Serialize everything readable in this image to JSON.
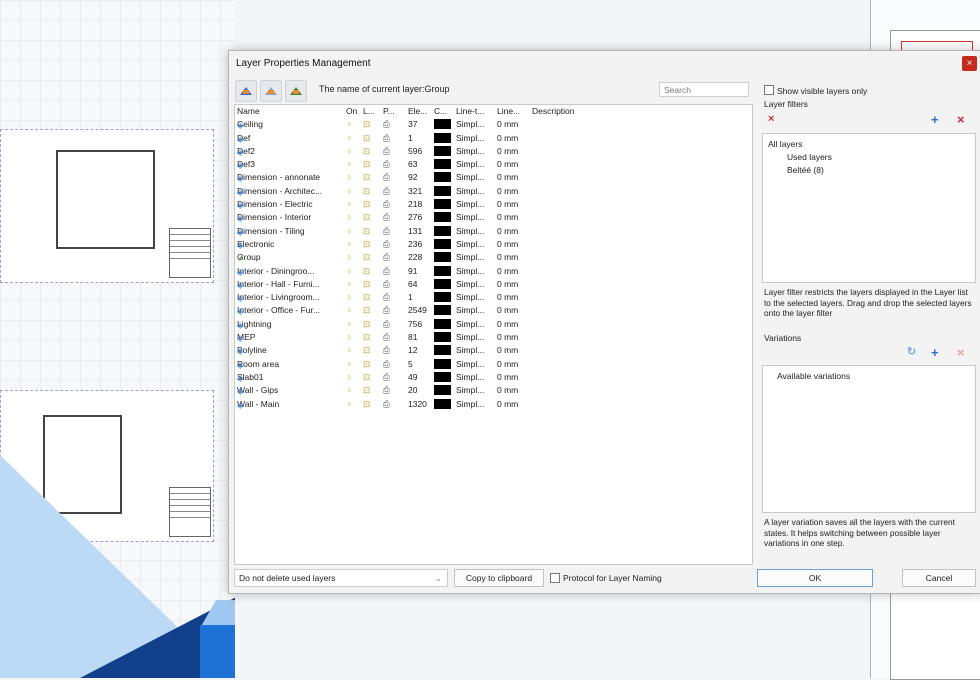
{
  "dialog": {
    "title": "Layer Properties Management",
    "close_glyph": "×",
    "current_layer_text": "The name of current layer:Group",
    "search_placeholder": "Search"
  },
  "columns": [
    "Name",
    "On",
    "L...",
    "P...",
    "Ele...",
    "C...",
    "Line-t...",
    "Line...",
    "Description"
  ],
  "layers": [
    {
      "name": "Ceiling",
      "count": "37",
      "linetype": "Simpl...",
      "lineweight": "0 mm"
    },
    {
      "name": "Def",
      "count": "1",
      "linetype": "Simpl...",
      "lineweight": "0 mm"
    },
    {
      "name": "Def2",
      "count": "596",
      "linetype": "Simpl...",
      "lineweight": "0 mm"
    },
    {
      "name": "Def3",
      "count": "63",
      "linetype": "Simpl...",
      "lineweight": "0 mm"
    },
    {
      "name": "Dimension - annonate",
      "count": "92",
      "linetype": "Simpl...",
      "lineweight": "0 mm"
    },
    {
      "name": "Dimension - Architec...",
      "count": "321",
      "linetype": "Simpl...",
      "lineweight": "0 mm"
    },
    {
      "name": "Dimension - Electric",
      "count": "218",
      "linetype": "Simpl...",
      "lineweight": "0 mm"
    },
    {
      "name": "Dimension - Interior",
      "count": "276",
      "linetype": "Simpl...",
      "lineweight": "0 mm"
    },
    {
      "name": "Dimension - Tiling",
      "count": "131",
      "linetype": "Simpl...",
      "lineweight": "0 mm"
    },
    {
      "name": "Electronic",
      "count": "236",
      "linetype": "Simpl...",
      "lineweight": "0 mm"
    },
    {
      "name": "Group",
      "count": "228",
      "linetype": "Simpl...",
      "lineweight": "0 mm",
      "current": true
    },
    {
      "name": "Interior - Diningroo...",
      "count": "91",
      "linetype": "Simpl...",
      "lineweight": "0 mm"
    },
    {
      "name": "Interior - Hall - Furni...",
      "count": "64",
      "linetype": "Simpl...",
      "lineweight": "0 mm"
    },
    {
      "name": "Interior - Livingroom...",
      "count": "1",
      "linetype": "Simpl...",
      "lineweight": "0 mm"
    },
    {
      "name": "Interior - Office - Fur...",
      "count": "2549",
      "linetype": "Simpl...",
      "lineweight": "0 mm"
    },
    {
      "name": "Lightning",
      "count": "756",
      "linetype": "Simpl...",
      "lineweight": "0 mm"
    },
    {
      "name": "MEP",
      "count": "81",
      "linetype": "Simpl...",
      "lineweight": "0 mm"
    },
    {
      "name": "Polyline",
      "count": "12",
      "linetype": "Simpl...",
      "lineweight": "0 mm"
    },
    {
      "name": "Room area",
      "count": "5",
      "linetype": "Simpl...",
      "lineweight": "0 mm"
    },
    {
      "name": "Slab01",
      "count": "49",
      "linetype": "Simpl...",
      "lineweight": "0 mm"
    },
    {
      "name": "Wall - Gips",
      "count": "20",
      "linetype": "Simpl...",
      "lineweight": "0 mm"
    },
    {
      "name": "Wall - Main",
      "count": "1320",
      "linetype": "Simpl...",
      "lineweight": "0 mm"
    }
  ],
  "bottom": {
    "delete_option": "Do not delete used layers",
    "copy_label": "Copy to clipboard",
    "protocol_label": "Protocol for Layer Naming",
    "ok_label": "OK",
    "cancel_label": "Cancel"
  },
  "right": {
    "show_visible_label": "Show visible layers only",
    "filters_label": "Layer filters",
    "tree": {
      "root": "All layers",
      "child1": "Used layers",
      "child2": "Beltéé (8)"
    },
    "filter_desc": "Layer filter restricts the layers displayed in the Layer list to the selected layers. Drag and drop the selected layers onto the layer filter",
    "variations_label": "Variations",
    "available_variations": "Available variations",
    "variation_desc": "A layer variation saves all the layers with the current states. It helps switching between possible layer variations in one step."
  },
  "glyphs": {
    "bulb": "♀",
    "lock": "⊡",
    "print": "⎙",
    "layer": "◈",
    "check": "✓",
    "plus": "+",
    "x": "×",
    "refresh": "↻",
    "chev": "⌄"
  },
  "colors": {
    "accent": "#2f6fd1",
    "close": "#c42b1c",
    "layer_color": "#000000"
  }
}
